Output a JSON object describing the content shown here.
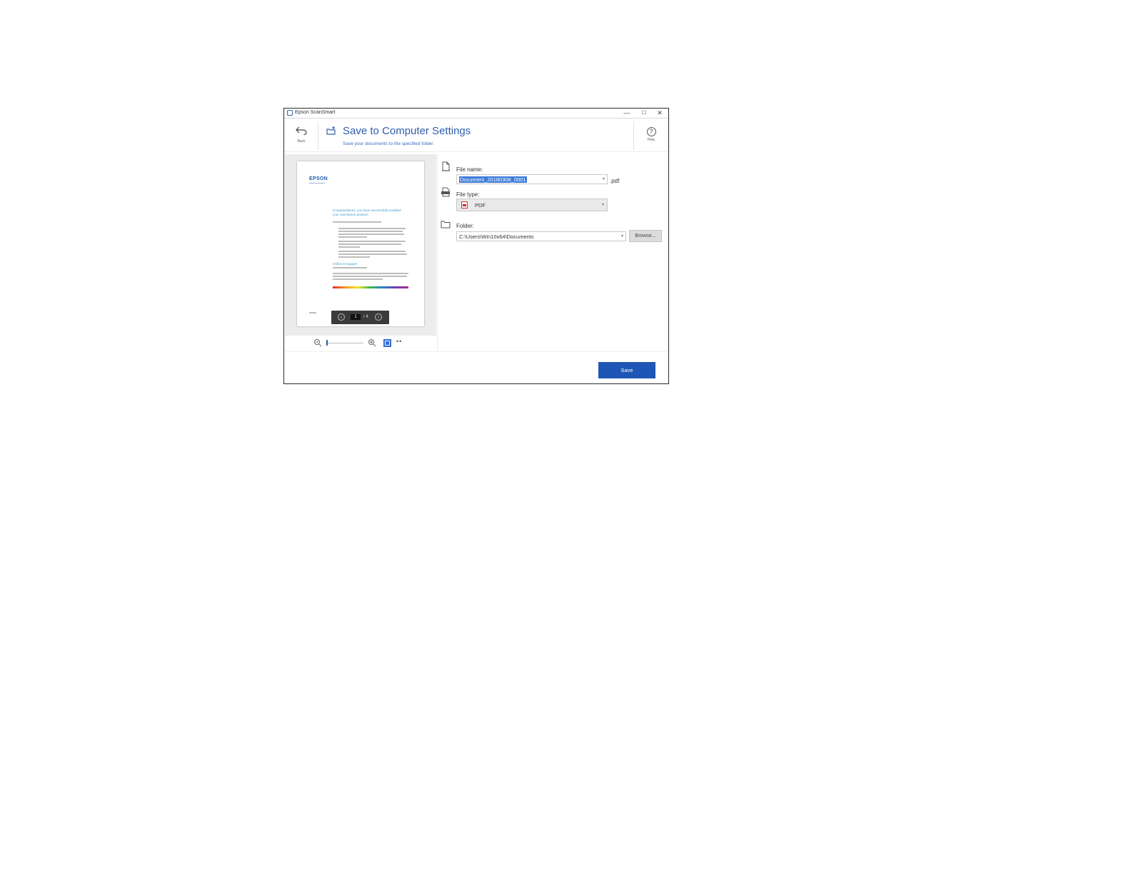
{
  "window": {
    "app_title": "Epson ScanSmart",
    "controls": {
      "minimize": "—",
      "maximize": "☐",
      "close": "✕"
    }
  },
  "header": {
    "back_label": "Back",
    "title": "Save to Computer Settings",
    "subtitle": "Save your documents to the specified folder.",
    "help_label": "Help"
  },
  "preview": {
    "logo": "EPSON",
    "heading": "Congratulations, you have successfully installed your new Epson product!",
    "sub_heading": "Online & Support",
    "pager": {
      "current_page": "1",
      "total": "/ 4",
      "prev_glyph": "‹",
      "next_glyph": "›"
    }
  },
  "form": {
    "file_name": {
      "label": "File name:",
      "value": "Document_20180308_0001",
      "extension": ".pdf"
    },
    "file_type": {
      "label": "File type:",
      "value": "PDF"
    },
    "folder": {
      "label": "Folder:",
      "value": "C:\\Users\\Win10x64\\Documents",
      "browse_label": "Browse..."
    }
  },
  "actions": {
    "save_label": "Save"
  },
  "colors": {
    "accent": "#1e56b5",
    "title": "#2f5faa",
    "selection": "#3d7bd9"
  },
  "icons": [
    "app-icon",
    "back-icon",
    "save-to-computer-icon",
    "help-icon",
    "file-icon",
    "file-type-icon",
    "folder-icon",
    "pdf-icon",
    "zoom-out-icon",
    "zoom-in-icon",
    "fit-page-icon",
    "more-icon"
  ]
}
